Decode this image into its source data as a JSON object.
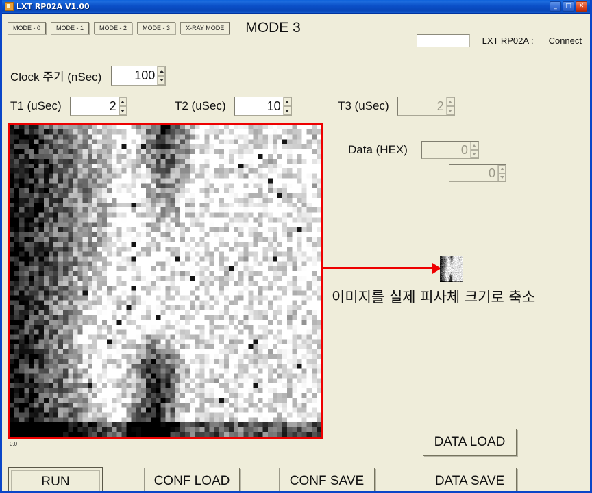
{
  "window": {
    "title": "LXT RP02A V1.00",
    "icon": "app-icon",
    "controls": {
      "minimize": "_",
      "maximize": "□",
      "close": "✕"
    }
  },
  "toolbar": {
    "modes": [
      {
        "label": "MODE - 0"
      },
      {
        "label": "MODE - 1"
      },
      {
        "label": "MODE - 2"
      },
      {
        "label": "MODE - 3"
      },
      {
        "label": "X-RAY MODE"
      }
    ],
    "current_mode_title": "MODE 3"
  },
  "connection": {
    "port_value": "",
    "device_label": "LXT RP02A :",
    "status": "Connect"
  },
  "timing": {
    "clock": {
      "label": "Clock 주기 (nSec)",
      "value": "100",
      "enabled": true
    },
    "t1": {
      "label": "T1 (uSec)",
      "value": "2",
      "enabled": true
    },
    "t2": {
      "label": "T2 (uSec)",
      "value": "10",
      "enabled": true
    },
    "t3": {
      "label": "T3 (uSec)",
      "value": "2",
      "enabled": false
    }
  },
  "data_hex": {
    "label": "Data  (HEX)",
    "value1": "0",
    "value2": "0",
    "enabled": false
  },
  "image_view": {
    "coordinate_label": "0,0",
    "border_color": "#ee0000",
    "grid_cols": 64,
    "grid_rows": 64
  },
  "annotation": {
    "caption": "이미지를 실제 피사체 크기로 축소",
    "arrow_color": "#ee0000"
  },
  "actions": {
    "run": "RUN",
    "conf_load": "CONF LOAD",
    "conf_save": "CONF SAVE",
    "data_load": "DATA LOAD",
    "data_save": "DATA SAVE"
  },
  "colors": {
    "window_background": "#efedda",
    "titlebar": "#0b50c8",
    "accent_red": "#ee0000",
    "text": "#111111"
  }
}
